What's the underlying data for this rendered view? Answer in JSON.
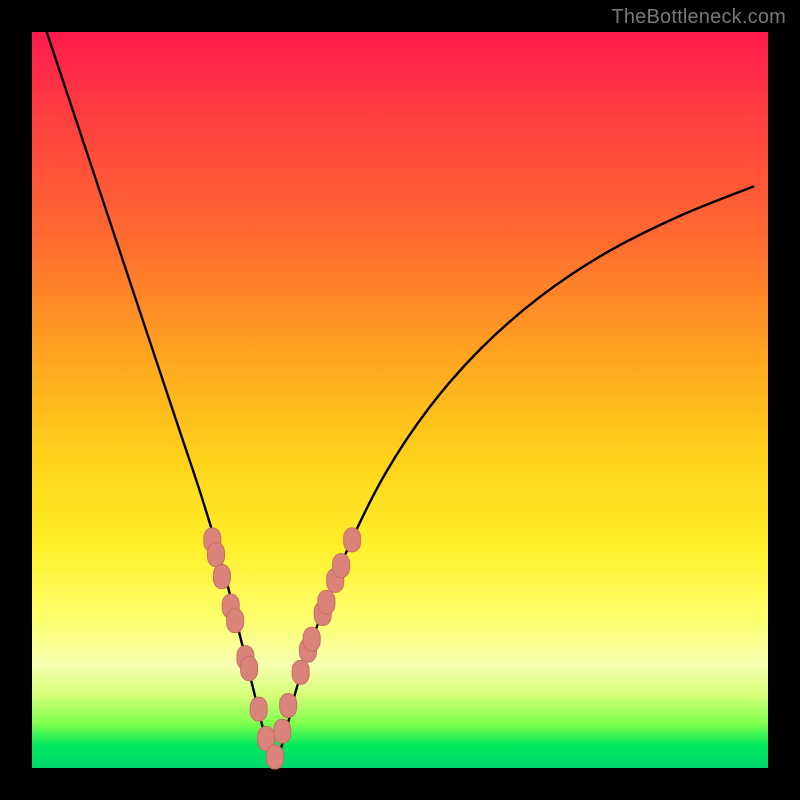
{
  "watermark": "TheBottleneck.com",
  "colors": {
    "curve": "#000000",
    "marker_fill": "#d9837a",
    "marker_stroke": "#c96e63",
    "bg_black": "#000000"
  },
  "chart_data": {
    "type": "line",
    "title": "",
    "xlabel": "",
    "ylabel": "",
    "xlim": [
      0,
      100
    ],
    "ylim": [
      0,
      100
    ],
    "series": [
      {
        "name": "bottleneck-curve",
        "x": [
          2,
          5,
          8,
          11,
          14,
          17,
          20,
          23,
          26,
          28,
          30,
          31.5,
          33,
          34.5,
          36,
          39,
          43,
          48,
          54,
          61,
          69,
          78,
          88,
          98
        ],
        "y": [
          100,
          91,
          82,
          73,
          64,
          55,
          46,
          37,
          27,
          19,
          11,
          5,
          1,
          5,
          11,
          20,
          30,
          40,
          49,
          57,
          64,
          70,
          75,
          79
        ]
      }
    ],
    "markers": {
      "name": "highlighted-points",
      "x": [
        24.5,
        25.0,
        25.8,
        27.0,
        27.6,
        29.0,
        29.5,
        30.8,
        31.8,
        33.0,
        34.0,
        34.8,
        36.5,
        37.5,
        38.0,
        39.5,
        40.0,
        41.2,
        42.0,
        43.5
      ],
      "y": [
        31,
        29,
        26,
        22,
        20,
        15,
        13.5,
        8,
        4,
        1.5,
        5,
        8.5,
        13,
        16,
        17.5,
        21,
        22.5,
        25.5,
        27.5,
        31
      ]
    }
  }
}
